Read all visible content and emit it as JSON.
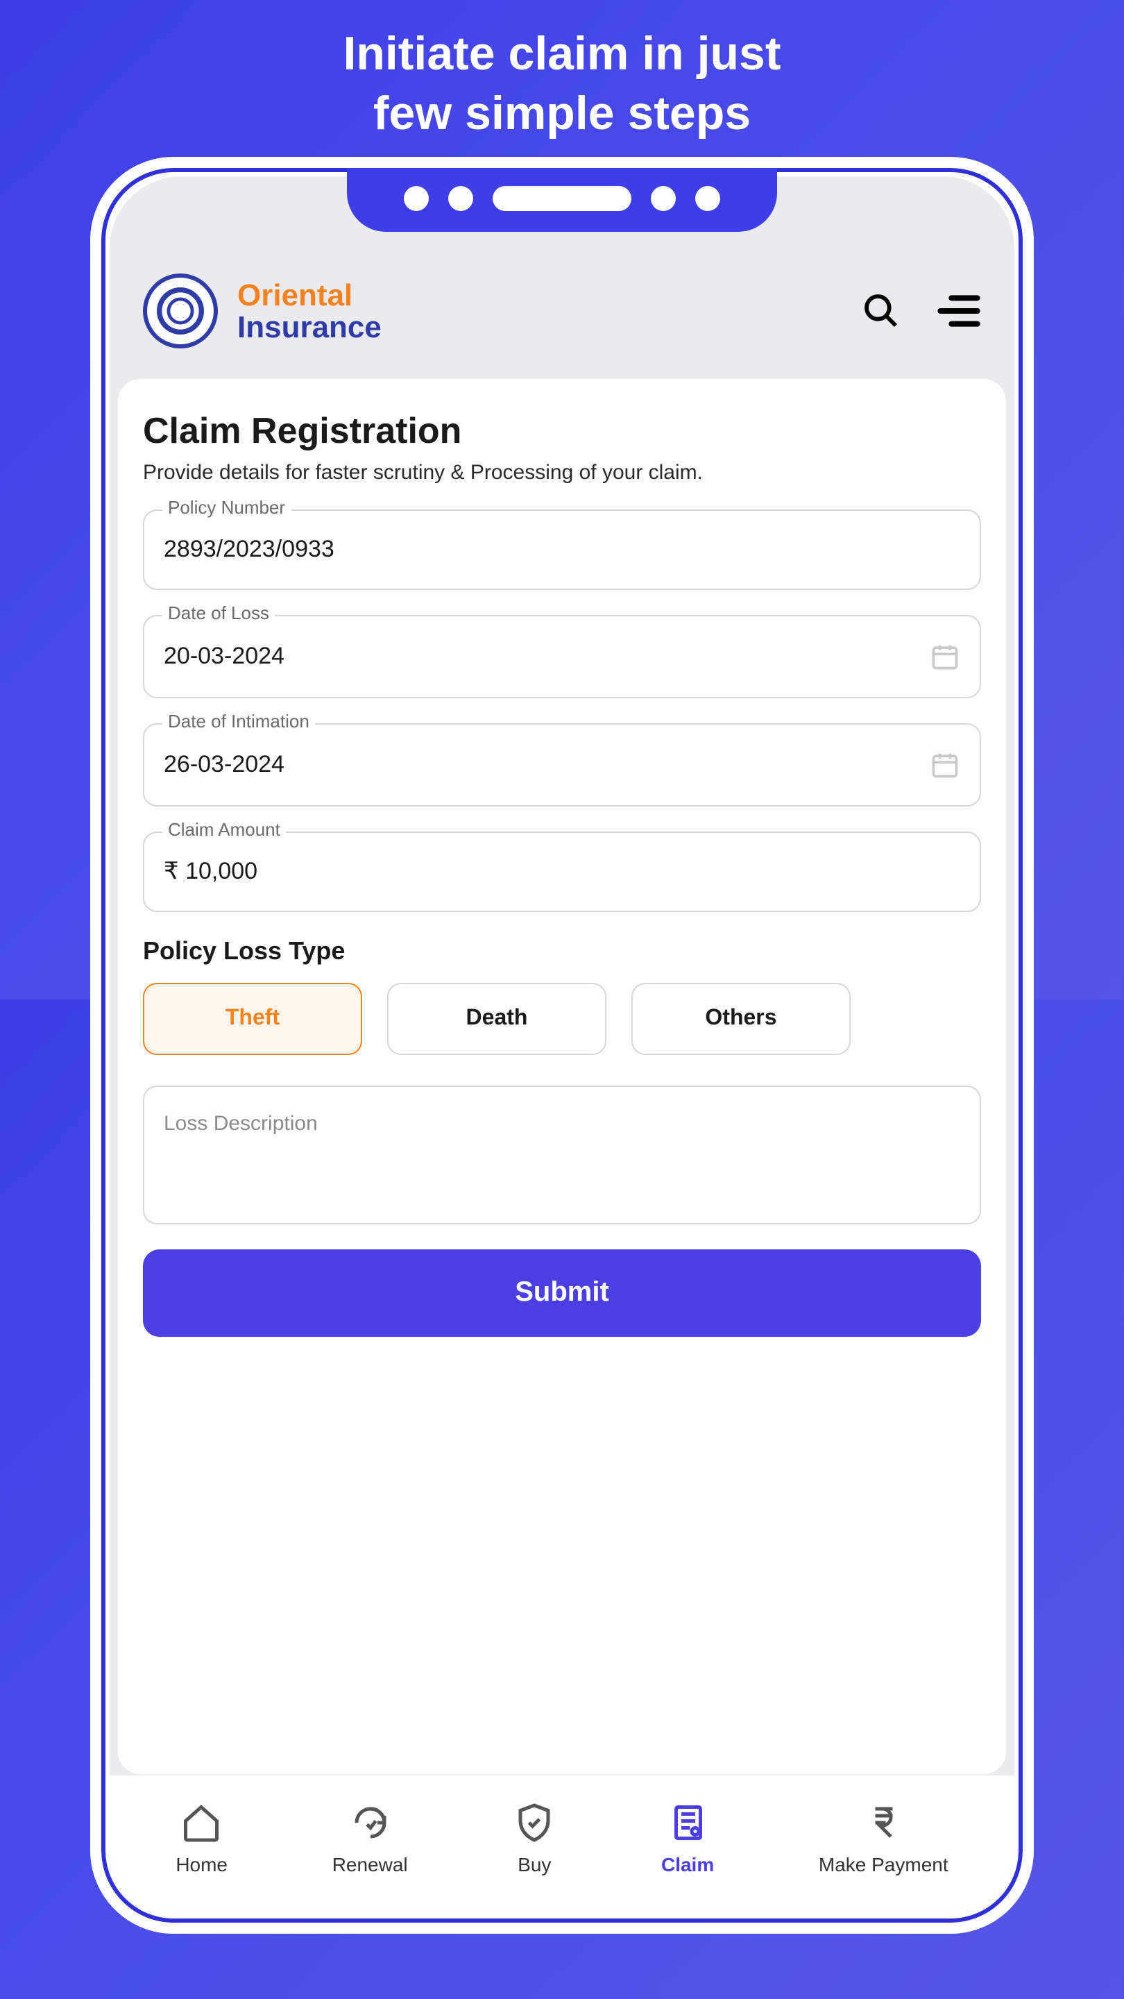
{
  "hero": {
    "line1": "Initiate claim in just",
    "line2": "few simple steps"
  },
  "header": {
    "company_line1": "Oriental",
    "company_line2": "Insurance"
  },
  "page": {
    "title": "Claim Registration",
    "subtitle": "Provide details for faster scrutiny & Processing of your claim."
  },
  "fields": {
    "policy_number": {
      "label": "Policy Number",
      "value": "2893/2023/0933"
    },
    "date_of_loss": {
      "label": "Date of Loss",
      "value": "20-03-2024"
    },
    "date_of_intimation": {
      "label": "Date of Intimation",
      "value": "26-03-2024"
    },
    "claim_amount": {
      "label": "Claim Amount",
      "value": "₹ 10,000"
    },
    "loss_type_label": "Policy Loss Type",
    "loss_types": {
      "theft": "Theft",
      "death": "Death",
      "others": "Others"
    },
    "loss_description_placeholder": "Loss Description"
  },
  "buttons": {
    "submit": "Submit"
  },
  "nav": {
    "home": "Home",
    "renewal": "Renewal",
    "buy": "Buy",
    "claim": "Claim",
    "make_payment": "Make Payment"
  }
}
